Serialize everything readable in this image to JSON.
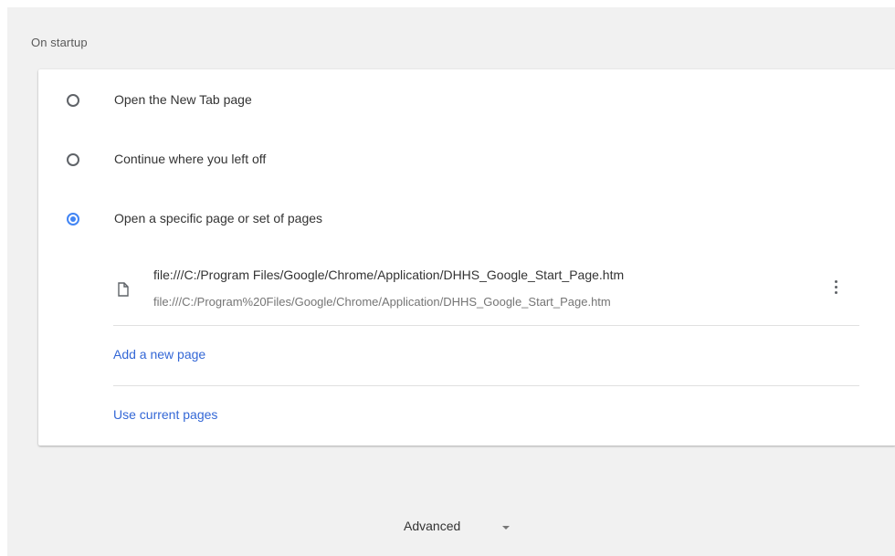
{
  "section": {
    "title": "On startup"
  },
  "startup_options": [
    {
      "label": "Open the New Tab page",
      "checked": false
    },
    {
      "label": "Continue where you left off",
      "checked": false
    },
    {
      "label": "Open a specific page or set of pages",
      "checked": true
    }
  ],
  "startup_page": {
    "title": "file:///C:/Program Files/Google/Chrome/Application/DHHS_Google_Start_Page.htm",
    "url": "file:///C:/Program%20Files/Google/Chrome/Application/DHHS_Google_Start_Page.htm",
    "icon": "file-icon",
    "menu_icon": "more-vert-icon"
  },
  "actions": {
    "add_page": "Add a new page",
    "use_current": "Use current pages"
  },
  "advanced": {
    "label": "Advanced",
    "icon": "chevron-down-icon"
  },
  "colors": {
    "accent": "#4285f4",
    "link": "#3367d6",
    "background": "#f1f1f1",
    "card": "#ffffff"
  }
}
